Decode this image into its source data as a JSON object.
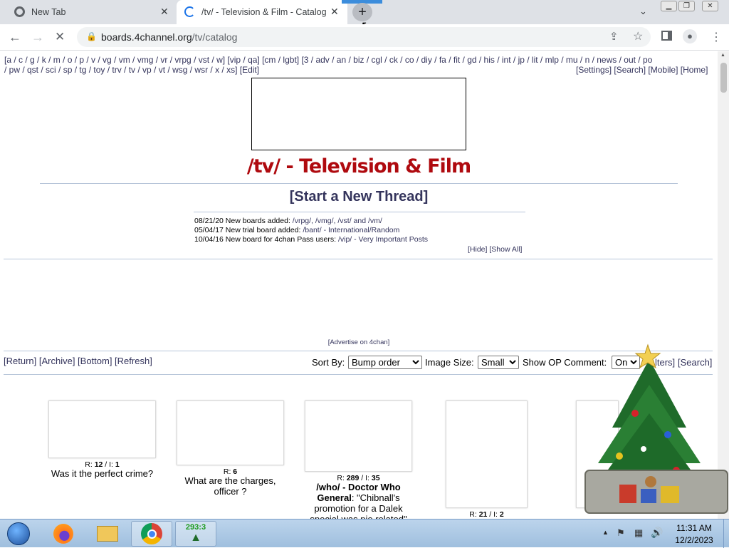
{
  "browser": {
    "tabs": [
      {
        "title": "New Tab"
      },
      {
        "title": "/tv/ - Television & Film - Catalog"
      }
    ],
    "newtab_label": "+",
    "url_host": "boards.4channel.org",
    "url_path": "/tv/catalog"
  },
  "boardnav": {
    "line1": "[a / c / g / k / m / o / p / v / vg / vm / vmg / vr / vrpg / vst / w] [vip / qa] [cm / lgbt] [3 / adv / an / biz / cgl / ck / co / diy / fa / fit / gd / his / int / jp / lit / mlp / mu / n / news / out / po",
    "line2": "/ pw / qst / sci / sp / tg / toy / trv / tv / vp / vt / wsg / wsr / x / xs] [Edit]",
    "right": "[Settings] [Search] [Mobile] [Home]"
  },
  "board": {
    "title": "/tv/ - Television & Film",
    "start_thread": "[Start a New Thread]"
  },
  "news": [
    {
      "date": "08/21/20",
      "text": "New boards added:",
      "link": "/vrpg/, /vmg/, /vst/ and /vm/"
    },
    {
      "date": "05/04/17",
      "text": "New trial board added:",
      "link": "/bant/ - International/Random"
    },
    {
      "date": "10/04/16",
      "text": "New board for 4chan Pass users:",
      "link": "/vip/ - Very Important Posts"
    }
  ],
  "hide_show": "[Hide] [Show All]",
  "advertise": "[Advertise on 4chan]",
  "controls": {
    "links_left": "[Return] [Archive] [Bottom] [Refresh]",
    "sort_by_label": "Sort By:",
    "sort_by_value": "Bump order",
    "image_size_label": "Image Size:",
    "image_size_value": "Small",
    "show_op_label": "Show OP Comment:",
    "show_op_value": "On",
    "filters": "lters]",
    "search": "[Search]"
  },
  "threads": [
    {
      "meta_r": "12",
      "meta_i": "1",
      "teaser": "Was it the perfect crime?"
    },
    {
      "meta_r": "6",
      "meta_i": "",
      "teaser": "What are the charges, officer ?"
    },
    {
      "meta_r": "289",
      "meta_i": "35",
      "subject": "/who/ - Doctor Who General",
      "teaser": ": \"Chibnall's promotion for a Dalek special was pie related\""
    },
    {
      "meta_r": "21",
      "meta_i": "2",
      "teaser": ""
    }
  ],
  "taskbar": {
    "tree_counter": "293:3",
    "time": "11:31 AM",
    "date": "12/2/2023"
  },
  "colors": {
    "board_title": "#af0a0f",
    "link": "#34345c"
  }
}
